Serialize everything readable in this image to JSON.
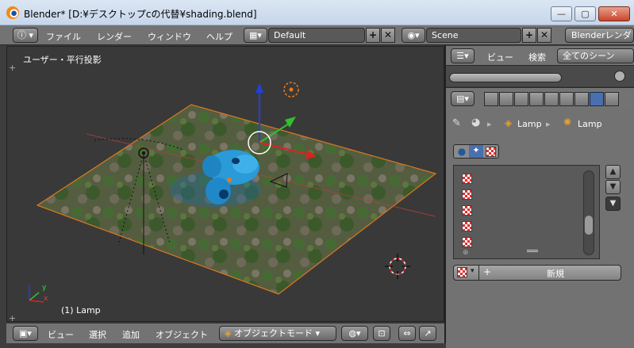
{
  "window": {
    "title": "Blender* [D:¥デスクトップcの代替¥shading.blend]",
    "minimize": "—",
    "maximize": "▢",
    "close": "✕"
  },
  "top_header": {
    "editor_icon": "ⓘ",
    "menus": [
      "ファイル",
      "レンダー",
      "ウィンドウ",
      "ヘルプ"
    ],
    "layout_value": "Default",
    "scene_value": "Scene",
    "add_label": "+",
    "remove_label": "✕",
    "engine_label": "Blenderレンダ"
  },
  "viewport": {
    "view_label": "ユーザー・平行投影",
    "object_label": "(1) Lamp",
    "axis_y": "y",
    "axis_x": "x"
  },
  "bottom_header": {
    "menus": [
      "ビュー",
      "選択",
      "追加",
      "オブジェクト"
    ],
    "mode_value": "オブジェクトモード"
  },
  "outliner": {
    "menus": [
      "ビュー",
      "検索"
    ],
    "filter_value": "全てのシーン"
  },
  "properties": {
    "breadcrumb": [
      "Lamp",
      "Lamp"
    ],
    "texture_slot_count": 5,
    "new_button_label": "新規",
    "list_add": "+",
    "list_remove": "−",
    "list_more": "▼"
  },
  "colors": {
    "accent_blue": "#4a6fae",
    "grass_dark": "#3b5530",
    "gizmo_x": "#e02020",
    "gizmo_y": "#30c030",
    "gizmo_z": "#2040e0",
    "suzanne": "#2a9ad8"
  }
}
